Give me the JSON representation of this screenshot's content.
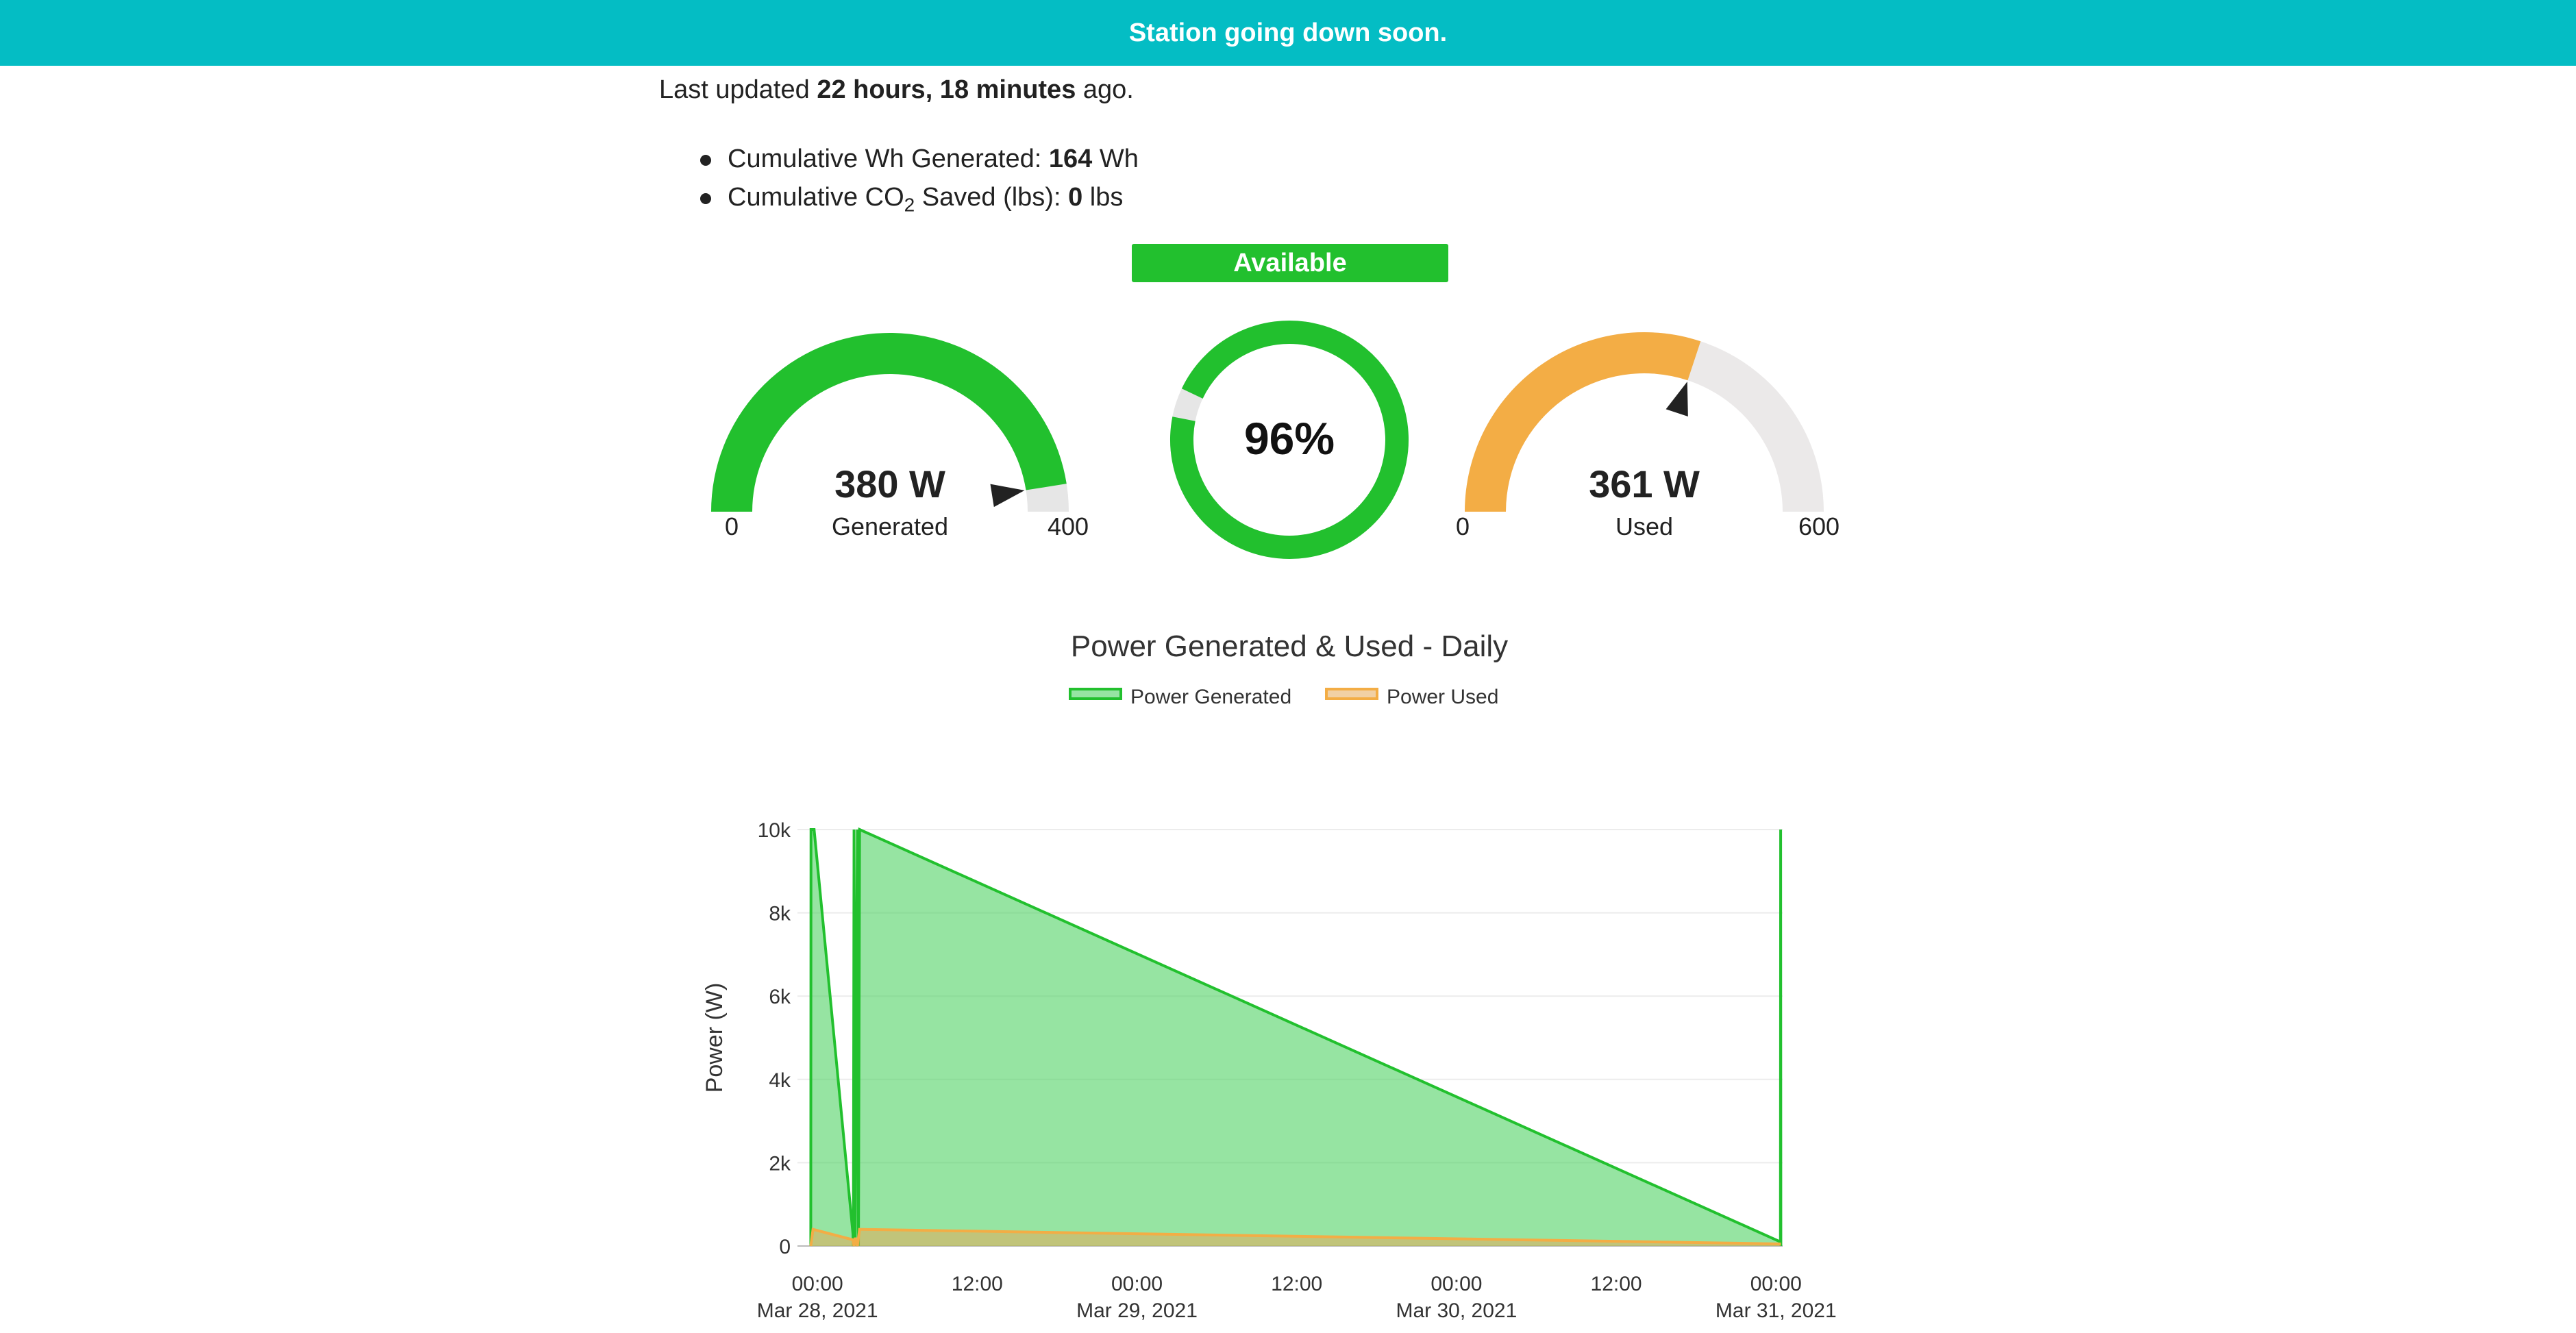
{
  "banner": {
    "text": "Station going down soon."
  },
  "updated": {
    "prefix": "Last updated ",
    "value": "22 hours, 18 minutes",
    "suffix": " ago."
  },
  "stats": {
    "wh_label": "Cumulative Wh Generated: ",
    "wh_value": "164",
    "wh_unit": " Wh",
    "co2_label_pre": "Cumulative CO",
    "co2_sub": "2",
    "co2_label_post": " Saved (lbs): ",
    "co2_value": "0",
    "co2_unit": " lbs"
  },
  "status": {
    "label": "Available",
    "color": "#22c02e"
  },
  "gauges": {
    "generated": {
      "value_text": "380 W",
      "label": "Generated",
      "min": "0",
      "max": "400",
      "value": 380,
      "max_value": 400,
      "color": "#22c02e"
    },
    "battery": {
      "value_text": "96%",
      "value": 96,
      "color": "#22c02e"
    },
    "used": {
      "value_text": "361 W",
      "label": "Used",
      "min": "0",
      "max": "600",
      "value": 361,
      "max_value": 600,
      "color": "#f3ad45"
    }
  },
  "chart_data": {
    "type": "area",
    "title": "Power Generated & Used - Daily",
    "ylabel": "Power (W)",
    "xlabel": "",
    "ylim": [
      0,
      10000
    ],
    "xlim": [
      "2021-03-27T22:30",
      "2021-03-31T00:30"
    ],
    "y_ticks": [
      {
        "value": 0,
        "label": "0"
      },
      {
        "value": 2000,
        "label": "2k"
      },
      {
        "value": 4000,
        "label": "4k"
      },
      {
        "value": 6000,
        "label": "6k"
      },
      {
        "value": 8000,
        "label": "8k"
      },
      {
        "value": 10000,
        "label": "10k"
      }
    ],
    "x_ticks": [
      {
        "value": "2021-03-28T00:00",
        "line1": "00:00",
        "line2": "Mar 28, 2021"
      },
      {
        "value": "2021-03-28T12:00",
        "line1": "12:00",
        "line2": ""
      },
      {
        "value": "2021-03-29T00:00",
        "line1": "00:00",
        "line2": "Mar 29, 2021"
      },
      {
        "value": "2021-03-29T12:00",
        "line1": "12:00",
        "line2": ""
      },
      {
        "value": "2021-03-30T00:00",
        "line1": "00:00",
        "line2": "Mar 30, 2021"
      },
      {
        "value": "2021-03-30T12:00",
        "line1": "12:00",
        "line2": ""
      },
      {
        "value": "2021-03-31T00:00",
        "line1": "00:00",
        "line2": "Mar 31, 2021"
      }
    ],
    "legend_position": "top-center",
    "grid": true,
    "series": [
      {
        "name": "Power Generated",
        "color": "#22c02e",
        "fill": "rgba(80,210,100,0.6)",
        "x": [
          "2021-03-27T23:30",
          "2021-03-27T23:31",
          "2021-03-27T23:40",
          "2021-03-27T23:45",
          "2021-03-28T02:40",
          "2021-03-28T02:42",
          "2021-03-28T02:45",
          "2021-03-28T02:50",
          "2021-03-28T03:00",
          "2021-03-28T03:05",
          "2021-03-28T03:10",
          "2021-03-31T00:20",
          "2021-03-31T00:21",
          "2021-03-31T00:22"
        ],
        "y": [
          0,
          10000,
          10000,
          10000,
          300,
          0,
          10000,
          0,
          10000,
          0,
          10000,
          100,
          10000,
          0
        ]
      },
      {
        "name": "Power Used",
        "color": "#f3ad45",
        "fill": "rgba(230,170,90,0.55)",
        "x": [
          "2021-03-27T23:30",
          "2021-03-27T23:40",
          "2021-03-28T02:40",
          "2021-03-28T02:45",
          "2021-03-28T02:50",
          "2021-03-28T03:00",
          "2021-03-28T03:10",
          "2021-03-31T00:22"
        ],
        "y": [
          0,
          400,
          150,
          0,
          200,
          0,
          400,
          50
        ]
      }
    ]
  }
}
